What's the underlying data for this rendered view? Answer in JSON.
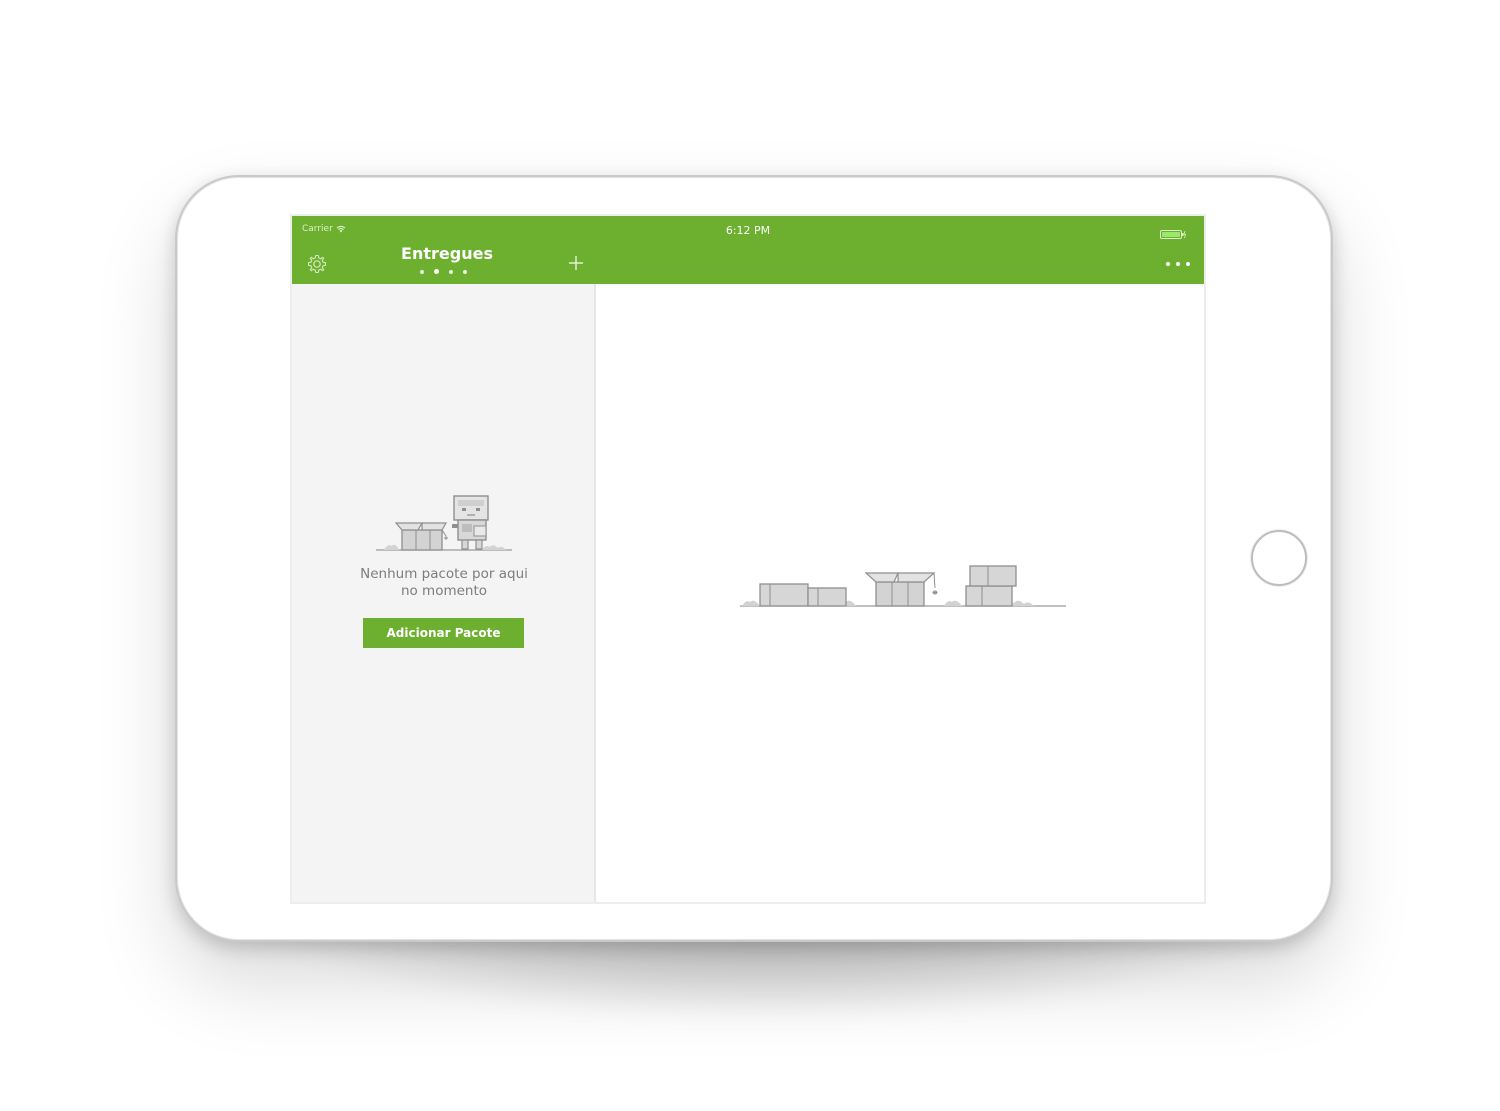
{
  "status_bar": {
    "carrier": "Carrier",
    "time": "6:12 PM"
  },
  "nav_bar": {
    "title": "Entregues",
    "page_count": 4,
    "active_page_index": 1
  },
  "master": {
    "empty_message_line1": "Nenhum pacote por aqui",
    "empty_message_line2": "no momento",
    "add_button_label": "Adicionar Pacote"
  },
  "icons": {
    "settings": "gear-icon",
    "add": "plus-icon",
    "more": "more-icon"
  },
  "colors": {
    "brand": "#6daf2f",
    "master_bg": "#f4f4f4",
    "text_muted": "#7d7d7d"
  }
}
